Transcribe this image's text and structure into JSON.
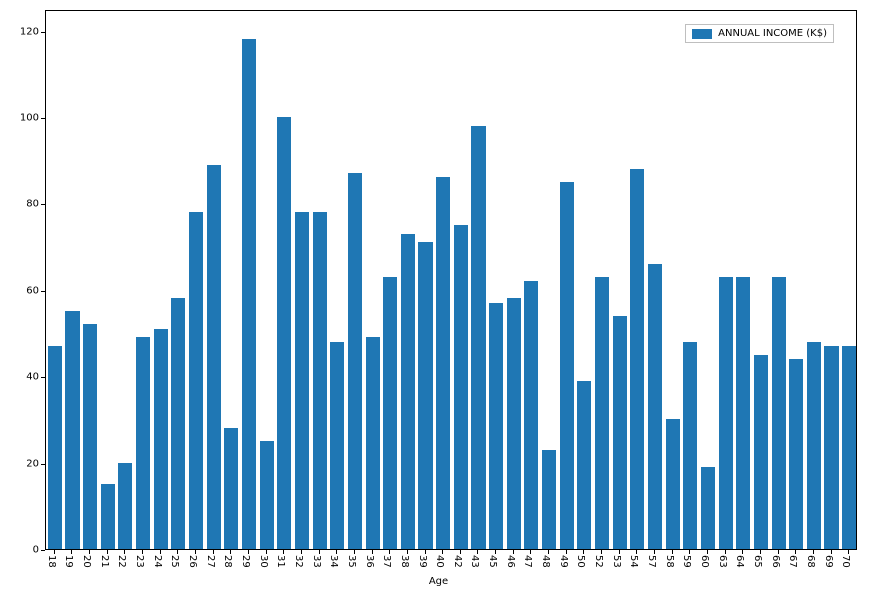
{
  "chart_data": {
    "type": "bar",
    "title": "",
    "xlabel": "Age",
    "ylabel": "",
    "ylim": [
      0,
      125
    ],
    "yticks": [
      0,
      20,
      40,
      60,
      80,
      100,
      120
    ],
    "categories": [
      "18",
      "19",
      "20",
      "21",
      "22",
      "23",
      "24",
      "25",
      "26",
      "27",
      "28",
      "29",
      "30",
      "31",
      "32",
      "33",
      "34",
      "35",
      "36",
      "37",
      "38",
      "39",
      "40",
      "42",
      "43",
      "45",
      "46",
      "47",
      "48",
      "49",
      "50",
      "52",
      "53",
      "54",
      "57",
      "58",
      "59",
      "60",
      "63",
      "64",
      "65",
      "66",
      "67",
      "68",
      "69",
      "70"
    ],
    "values": [
      47,
      55,
      52,
      15,
      20,
      49,
      51,
      58,
      78,
      89,
      28,
      118,
      25,
      100,
      78,
      78,
      48,
      87,
      49,
      63,
      73,
      71,
      86,
      75,
      98,
      57,
      58,
      62,
      23,
      85,
      39,
      63,
      54,
      88,
      66,
      30,
      48,
      19,
      63,
      63,
      45,
      63,
      44,
      48,
      47,
      47
    ],
    "series": [
      {
        "name": "ANNUAL INCOME (K$)",
        "color": "#1f77b4"
      }
    ],
    "legend_position": "upper right"
  }
}
